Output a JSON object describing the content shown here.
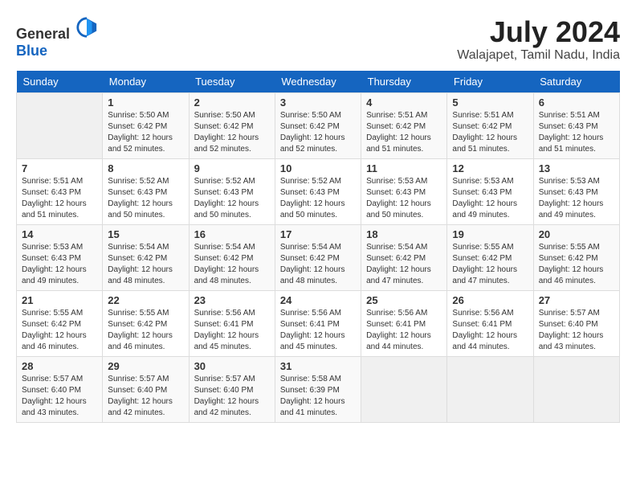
{
  "header": {
    "logo": {
      "general": "General",
      "blue": "Blue"
    },
    "title": "July 2024",
    "location": "Walajapet, Tamil Nadu, India"
  },
  "calendar": {
    "days_header": [
      "Sunday",
      "Monday",
      "Tuesday",
      "Wednesday",
      "Thursday",
      "Friday",
      "Saturday"
    ],
    "weeks": [
      [
        {
          "day": "",
          "info": ""
        },
        {
          "day": "1",
          "info": "Sunrise: 5:50 AM\nSunset: 6:42 PM\nDaylight: 12 hours\nand 52 minutes."
        },
        {
          "day": "2",
          "info": "Sunrise: 5:50 AM\nSunset: 6:42 PM\nDaylight: 12 hours\nand 52 minutes."
        },
        {
          "day": "3",
          "info": "Sunrise: 5:50 AM\nSunset: 6:42 PM\nDaylight: 12 hours\nand 52 minutes."
        },
        {
          "day": "4",
          "info": "Sunrise: 5:51 AM\nSunset: 6:42 PM\nDaylight: 12 hours\nand 51 minutes."
        },
        {
          "day": "5",
          "info": "Sunrise: 5:51 AM\nSunset: 6:42 PM\nDaylight: 12 hours\nand 51 minutes."
        },
        {
          "day": "6",
          "info": "Sunrise: 5:51 AM\nSunset: 6:43 PM\nDaylight: 12 hours\nand 51 minutes."
        }
      ],
      [
        {
          "day": "7",
          "info": "Sunrise: 5:51 AM\nSunset: 6:43 PM\nDaylight: 12 hours\nand 51 minutes."
        },
        {
          "day": "8",
          "info": "Sunrise: 5:52 AM\nSunset: 6:43 PM\nDaylight: 12 hours\nand 50 minutes."
        },
        {
          "day": "9",
          "info": "Sunrise: 5:52 AM\nSunset: 6:43 PM\nDaylight: 12 hours\nand 50 minutes."
        },
        {
          "day": "10",
          "info": "Sunrise: 5:52 AM\nSunset: 6:43 PM\nDaylight: 12 hours\nand 50 minutes."
        },
        {
          "day": "11",
          "info": "Sunrise: 5:53 AM\nSunset: 6:43 PM\nDaylight: 12 hours\nand 50 minutes."
        },
        {
          "day": "12",
          "info": "Sunrise: 5:53 AM\nSunset: 6:43 PM\nDaylight: 12 hours\nand 49 minutes."
        },
        {
          "day": "13",
          "info": "Sunrise: 5:53 AM\nSunset: 6:43 PM\nDaylight: 12 hours\nand 49 minutes."
        }
      ],
      [
        {
          "day": "14",
          "info": "Sunrise: 5:53 AM\nSunset: 6:43 PM\nDaylight: 12 hours\nand 49 minutes."
        },
        {
          "day": "15",
          "info": "Sunrise: 5:54 AM\nSunset: 6:42 PM\nDaylight: 12 hours\nand 48 minutes."
        },
        {
          "day": "16",
          "info": "Sunrise: 5:54 AM\nSunset: 6:42 PM\nDaylight: 12 hours\nand 48 minutes."
        },
        {
          "day": "17",
          "info": "Sunrise: 5:54 AM\nSunset: 6:42 PM\nDaylight: 12 hours\nand 48 minutes."
        },
        {
          "day": "18",
          "info": "Sunrise: 5:54 AM\nSunset: 6:42 PM\nDaylight: 12 hours\nand 47 minutes."
        },
        {
          "day": "19",
          "info": "Sunrise: 5:55 AM\nSunset: 6:42 PM\nDaylight: 12 hours\nand 47 minutes."
        },
        {
          "day": "20",
          "info": "Sunrise: 5:55 AM\nSunset: 6:42 PM\nDaylight: 12 hours\nand 46 minutes."
        }
      ],
      [
        {
          "day": "21",
          "info": "Sunrise: 5:55 AM\nSunset: 6:42 PM\nDaylight: 12 hours\nand 46 minutes."
        },
        {
          "day": "22",
          "info": "Sunrise: 5:55 AM\nSunset: 6:42 PM\nDaylight: 12 hours\nand 46 minutes."
        },
        {
          "day": "23",
          "info": "Sunrise: 5:56 AM\nSunset: 6:41 PM\nDaylight: 12 hours\nand 45 minutes."
        },
        {
          "day": "24",
          "info": "Sunrise: 5:56 AM\nSunset: 6:41 PM\nDaylight: 12 hours\nand 45 minutes."
        },
        {
          "day": "25",
          "info": "Sunrise: 5:56 AM\nSunset: 6:41 PM\nDaylight: 12 hours\nand 44 minutes."
        },
        {
          "day": "26",
          "info": "Sunrise: 5:56 AM\nSunset: 6:41 PM\nDaylight: 12 hours\nand 44 minutes."
        },
        {
          "day": "27",
          "info": "Sunrise: 5:57 AM\nSunset: 6:40 PM\nDaylight: 12 hours\nand 43 minutes."
        }
      ],
      [
        {
          "day": "28",
          "info": "Sunrise: 5:57 AM\nSunset: 6:40 PM\nDaylight: 12 hours\nand 43 minutes."
        },
        {
          "day": "29",
          "info": "Sunrise: 5:57 AM\nSunset: 6:40 PM\nDaylight: 12 hours\nand 42 minutes."
        },
        {
          "day": "30",
          "info": "Sunrise: 5:57 AM\nSunset: 6:40 PM\nDaylight: 12 hours\nand 42 minutes."
        },
        {
          "day": "31",
          "info": "Sunrise: 5:58 AM\nSunset: 6:39 PM\nDaylight: 12 hours\nand 41 minutes."
        },
        {
          "day": "",
          "info": ""
        },
        {
          "day": "",
          "info": ""
        },
        {
          "day": "",
          "info": ""
        }
      ]
    ]
  }
}
